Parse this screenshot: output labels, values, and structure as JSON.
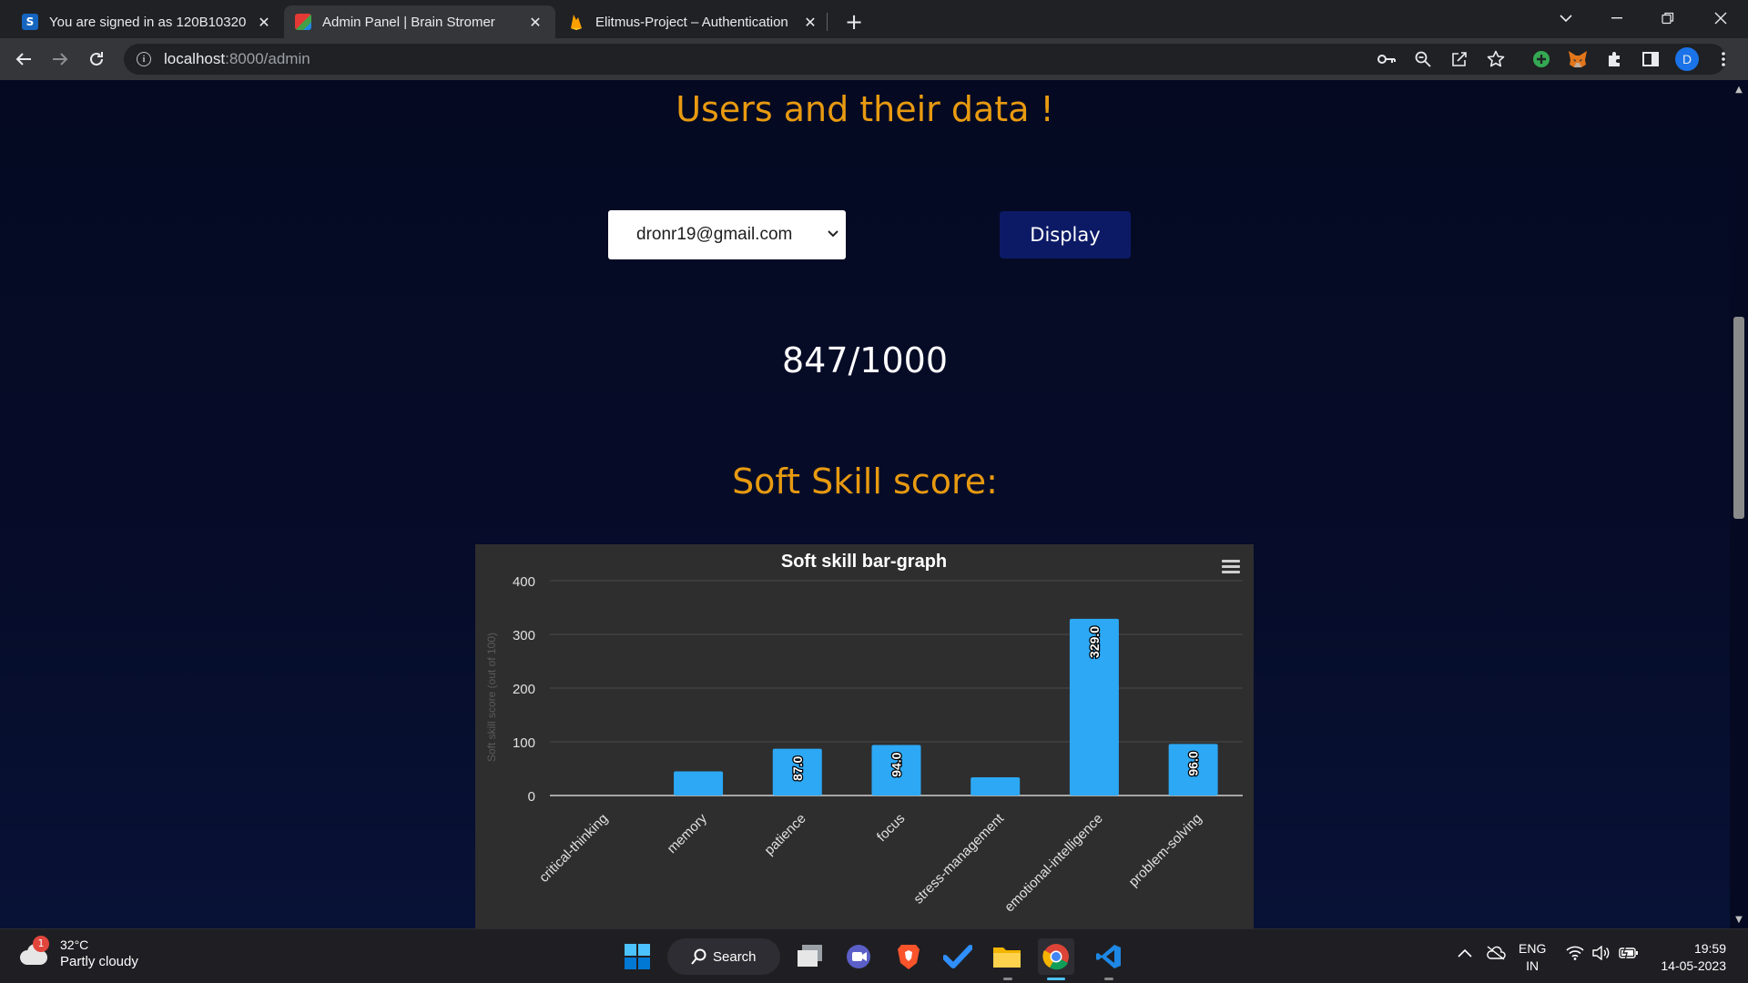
{
  "browser": {
    "tabs": [
      {
        "title": "You are signed in as 120B10320",
        "favicon": "s-letter-icon",
        "favicon_color": "#1565c0",
        "active": false
      },
      {
        "title": "Admin Panel | Brain Stromer",
        "favicon": "brain-logo-icon",
        "favicon_color": "#e53935",
        "active": true
      },
      {
        "title": "Elitmus-Project – Authentication",
        "favicon": "firebase-icon",
        "favicon_color": "#ffa000",
        "active": false
      }
    ],
    "url_host": "localhost",
    "url_path": ":8000/admin",
    "profile_initial": "D",
    "profile_color": "#1a73e8"
  },
  "page": {
    "heading": "Users and their data !",
    "user_select_value": "dronr19@gmail.com",
    "display_button": "Display",
    "score": "847/1000",
    "soft_skill_heading": "Soft Skill score:",
    "accent_color": "#e89a10",
    "button_color": "#0c1a66"
  },
  "chart_data": {
    "type": "bar",
    "title": "Soft skill bar-graph",
    "ylabel": "Soft skill score (out of 100)",
    "ylim": [
      0,
      400
    ],
    "yticks": [
      0,
      100,
      200,
      300,
      400
    ],
    "categories": [
      "critical-thinking",
      "memory",
      "patience",
      "focus",
      "stress-management",
      "emotional-intelligence",
      "problem-solving"
    ],
    "values": [
      0,
      45,
      87,
      94,
      34,
      329,
      96
    ],
    "data_labels": [
      "",
      "",
      "87.0",
      "94.0",
      "",
      "329.0",
      "96.0"
    ],
    "bar_color": "#2ca8f5",
    "grid": true,
    "legend": "none"
  },
  "taskbar": {
    "weather_temp": "32°C",
    "weather_condition": "Partly cloudy",
    "weather_badge": "1",
    "search_label": "Search",
    "lang_top": "ENG",
    "lang_bottom": "IN",
    "time": "19:59",
    "date": "14-05-2023"
  }
}
